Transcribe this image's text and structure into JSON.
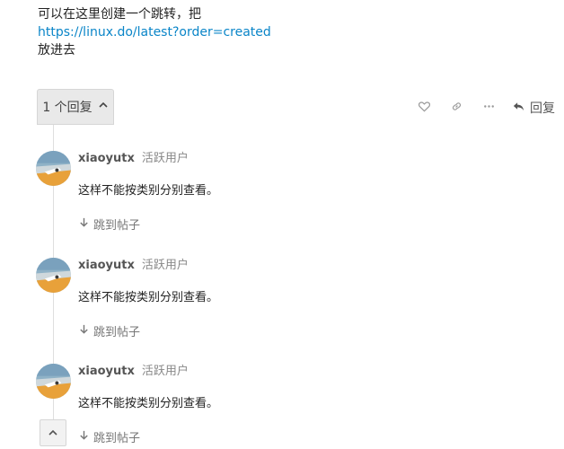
{
  "post": {
    "line1": "可以在这里创建一个跳转，把",
    "link": "https://linux.do/latest?order=created",
    "line3": "放进去"
  },
  "replies_toggle": {
    "label": "1 个回复"
  },
  "controls": {
    "reply_label": "回复"
  },
  "replies": [
    {
      "username": "xiaoyutx",
      "user_title": "活跃用户",
      "text": "这样不能按类别分别查看。",
      "jump_label": "跳到帖子"
    },
    {
      "username": "xiaoyutx",
      "user_title": "活跃用户",
      "text": "这样不能按类别分别查看。",
      "jump_label": "跳到帖子"
    },
    {
      "username": "xiaoyutx",
      "user_title": "活跃用户",
      "text": "这样不能按类别分别查看。",
      "jump_label": "跳到帖子"
    }
  ],
  "colors": {
    "link": "#0a85c8",
    "muted": "#888888",
    "text": "#222222"
  },
  "icons": [
    "chevron-up-icon",
    "heart-icon",
    "link-icon",
    "ellipsis-icon",
    "reply-icon",
    "arrow-down-icon"
  ]
}
